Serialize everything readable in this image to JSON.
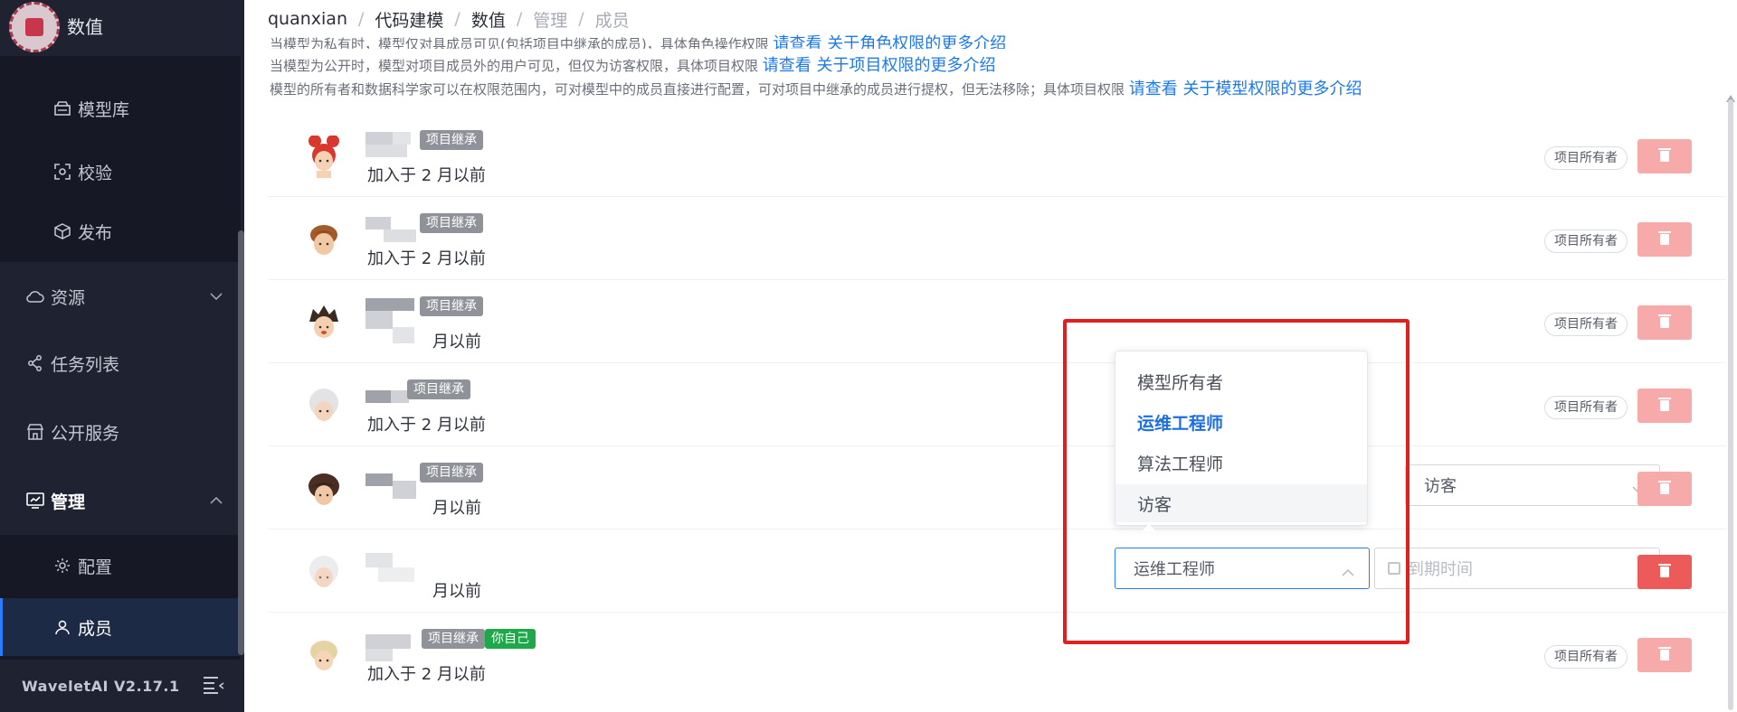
{
  "app": {
    "title": "数值",
    "version": "WaveletAI V2.17.1"
  },
  "sidebar": {
    "items": [
      {
        "label": "模型库",
        "icon": "model-library-icon"
      },
      {
        "label": "校验",
        "icon": "scan-icon"
      },
      {
        "label": "发布",
        "icon": "cube-icon"
      },
      {
        "label": "资源",
        "icon": "cloud-icon"
      },
      {
        "label": "任务列表",
        "icon": "share-nodes-icon"
      },
      {
        "label": "公开服务",
        "icon": "store-icon"
      },
      {
        "label": "管理",
        "icon": "management-icon"
      },
      {
        "label": "配置",
        "icon": "gear-icon"
      },
      {
        "label": "成员",
        "icon": "user-icon"
      }
    ]
  },
  "breadcrumb": [
    "quanxian",
    "代码建模",
    "数值",
    "管理",
    "成员"
  ],
  "info": {
    "line1_text": "当模型为私有时，模型仅对具成员可见(包括项目中继承的成员)，具体角色操作权限",
    "line1_link": "请查看 关于角色权限的更多介绍",
    "line2_text": "当模型为公开时，模型对项目成员外的用户可见，但仅为访客权限，具体项目权限",
    "line2_link": "请查看 关于项目权限的更多介绍",
    "line3_text": "模型的所有者和数据科学家可以在权限范围内，可对模型中的成员直接进行配置，可对项目中继承的成员进行提权，但无法移除；具体项目权限",
    "line3_link": "请查看 关于模型权限的更多介绍"
  },
  "members": [
    {
      "tag": "项目继承",
      "joined": "加入于 2 月以前",
      "role": "项目所有者"
    },
    {
      "tag": "项目继承",
      "joined": "加入于 2 月以前",
      "role": "项目所有者"
    },
    {
      "tag": "项目继承",
      "joined": "月以前",
      "role": "项目所有者"
    },
    {
      "tag": "项目继承",
      "joined": "加入于 2 月以前",
      "role": "项目所有者"
    },
    {
      "tag": "项目继承",
      "joined": "月以前",
      "role_select": "访客"
    },
    {
      "joined": "月以前",
      "role_select": "运维工程师",
      "expire_placeholder": "到期时间"
    },
    {
      "tag": "项目继承",
      "self_tag": "你自己",
      "joined": "加入于 2 月以前",
      "role": "项目所有者"
    }
  ],
  "dropdown": {
    "options": [
      "模型所有者",
      "运维工程师",
      "算法工程师",
      "访客"
    ],
    "selected": "运维工程师",
    "hovered": "访客"
  },
  "colors": {
    "sidebar_bg": "#1f2231",
    "link": "#1c7ae8",
    "delete_light": "#f7aaaa",
    "delete_active": "#ec5a5a",
    "highlight": "#e0201c",
    "self_tag": "#1ea84a"
  }
}
